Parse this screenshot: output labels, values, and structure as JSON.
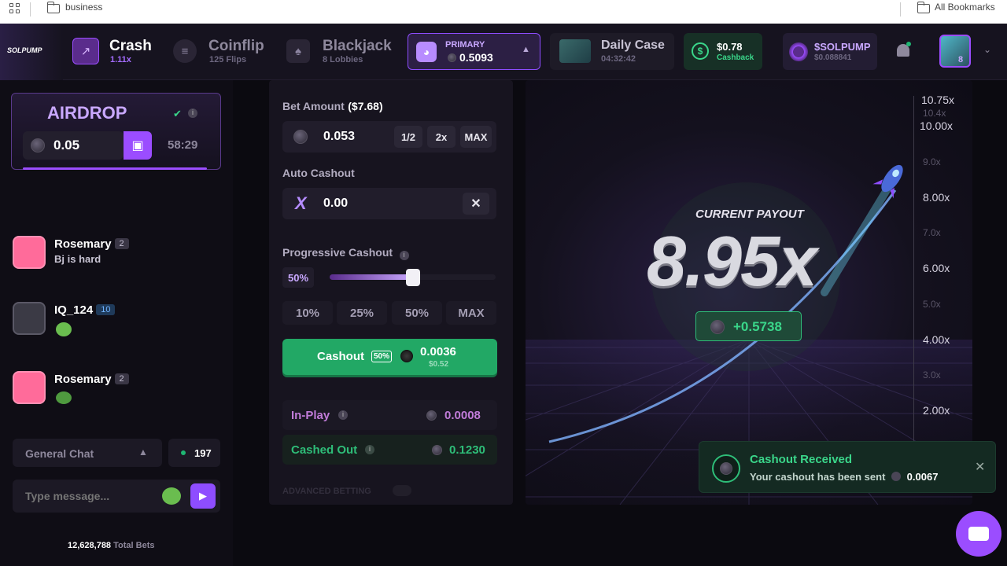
{
  "bookmarks": {
    "folder": "business",
    "all": "All Bookmarks"
  },
  "nav": {
    "logo": "SOLPUMP",
    "crash": {
      "title": "Crash",
      "sub": "1.11x"
    },
    "coinflip": {
      "title": "Coinflip",
      "sub": "125 Flips"
    },
    "blackjack": {
      "title": "Blackjack",
      "sub": "8 Lobbies"
    },
    "wallet": {
      "label": "PRIMARY",
      "balance": "0.5093"
    },
    "daily_case": {
      "title": "Daily Case",
      "timer": "04:32:42"
    },
    "cashback": {
      "amount": "$0.78",
      "label": "Cashback"
    },
    "token": {
      "name": "$SOLPUMP",
      "price": "$0.088841"
    },
    "avatar_badge": "8"
  },
  "airdrop": {
    "title": "AIRDROP",
    "amount": "0.05",
    "timer": "58:29"
  },
  "chat": {
    "messages": [
      {
        "name": "Rosemary",
        "level": "2",
        "text": "Bj is hard"
      },
      {
        "name": "IQ_124",
        "level": "10",
        "text": ""
      },
      {
        "name": "Rosemary",
        "level": "2",
        "text": ""
      }
    ],
    "channel": "General Chat",
    "online": "197",
    "placeholder": "Type message...",
    "total_bets": "12,628,788",
    "total_bets_label": "Total Bets"
  },
  "bet": {
    "amount_label": "Bet Amount",
    "amount_usd": "($7.68)",
    "amount": "0.053",
    "half": "1/2",
    "double": "2x",
    "max": "MAX",
    "auto_label": "Auto Cashout",
    "auto_value": "0.00",
    "prog_label": "Progressive Cashout",
    "prog_value": "50%",
    "prog_fraction": 0.5,
    "presets": [
      "10%",
      "25%",
      "50%",
      "MAX"
    ],
    "cashout_label": "Cashout",
    "cashout_pct": "50%",
    "cashout_amount": "0.0036",
    "cashout_usd": "$0.52",
    "inplay_label": "In-Play",
    "inplay_value": "0.0008",
    "cashedout_label": "Cashed Out",
    "cashedout_value": "0.1230",
    "advanced_label": "ADVANCED BETTING"
  },
  "game": {
    "payout_label": "CURRENT PAYOUT",
    "multiplier": "8.95x",
    "profit": "+0.5738",
    "axis_major": [
      "10.75x",
      "10.00x",
      "8.00x",
      "6.00x",
      "4.00x",
      "2.00x"
    ],
    "axis_minor": [
      "10.4x",
      "9.0x",
      "7.0x",
      "5.0x",
      "3.0x"
    ]
  },
  "toast": {
    "title": "Cashout Received",
    "text": "Your cashout has been sent",
    "amount": "0.0067"
  },
  "colors": {
    "accent": "#9b4dff",
    "green": "#1fb673",
    "cashout": "#22a865"
  }
}
